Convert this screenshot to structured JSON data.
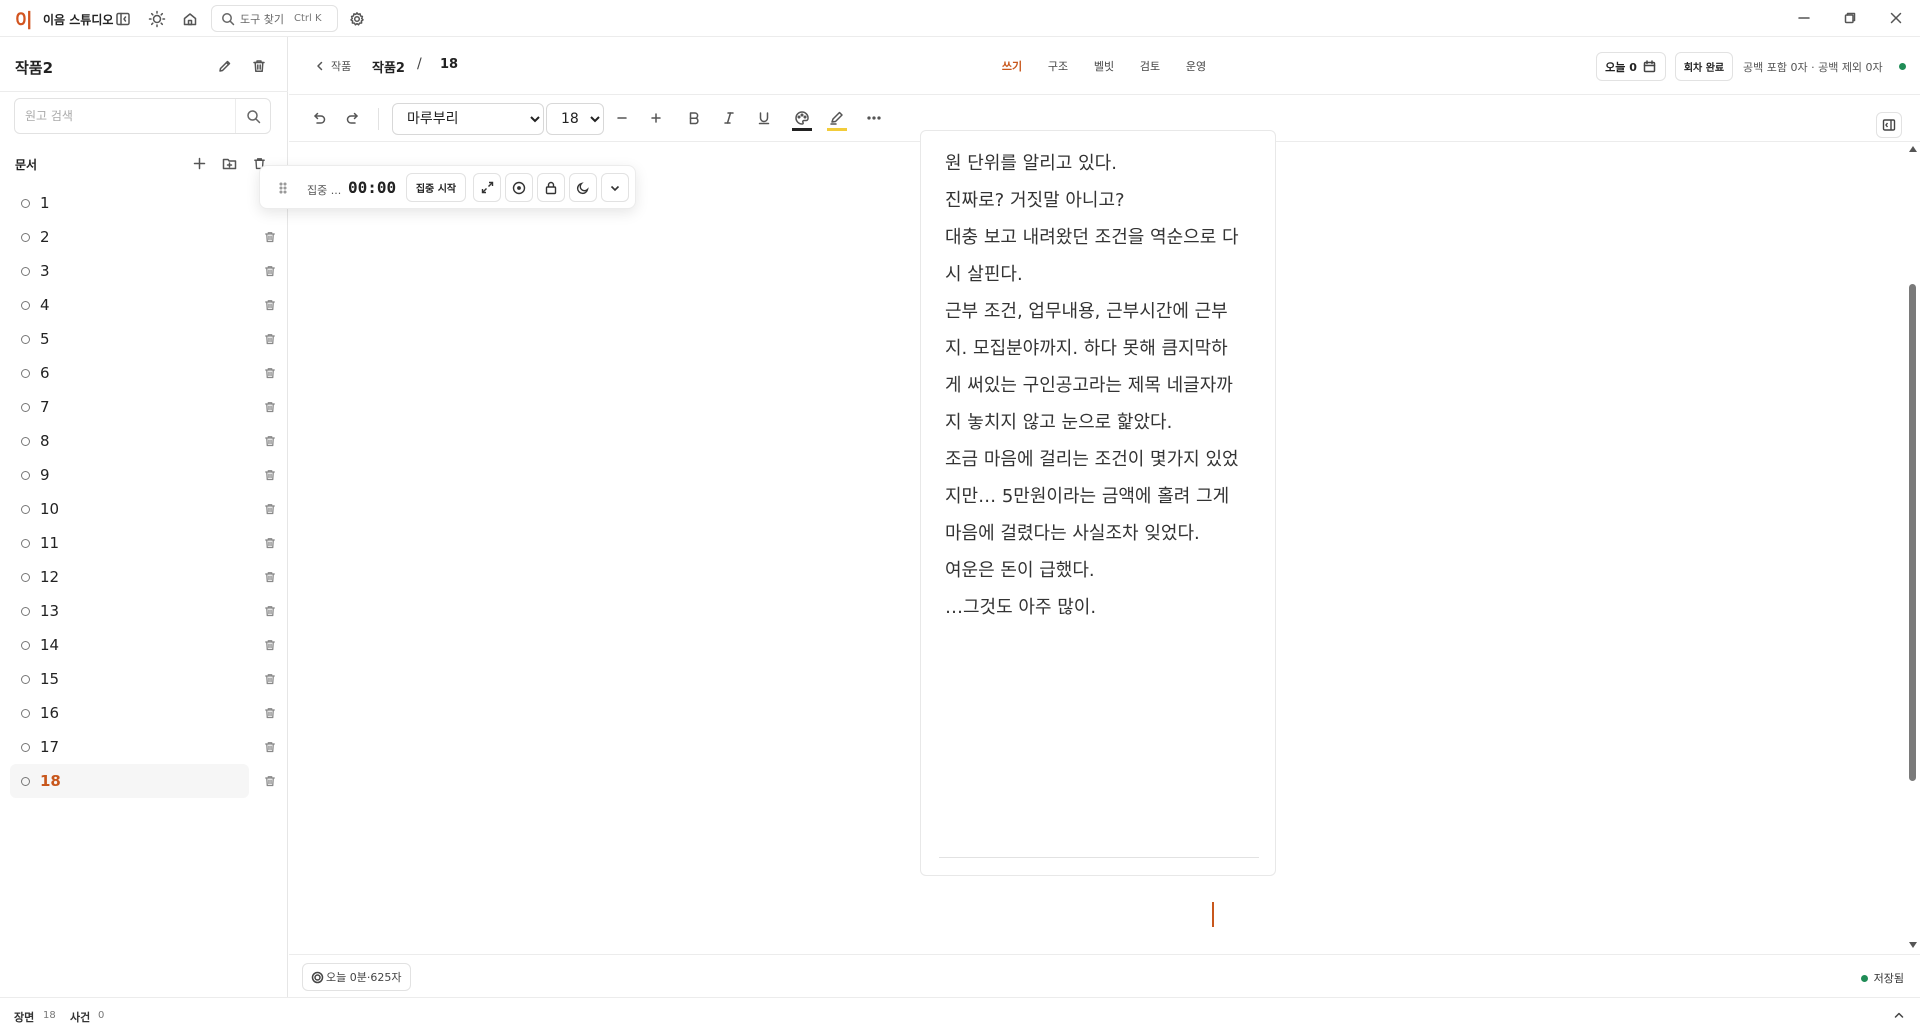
{
  "app": {
    "logo": "이",
    "name": "이음 스튜디오",
    "search_label": "도구 찾기",
    "search_shortcut": "Ctrl K"
  },
  "sidebar": {
    "project_title": "작품2",
    "draft_search_placeholder": "원고 검색",
    "docs_heading": "문서",
    "docs": [
      "1",
      "2",
      "3",
      "4",
      "5",
      "6",
      "7",
      "8",
      "9",
      "10",
      "11",
      "12",
      "13",
      "14",
      "15",
      "16",
      "17",
      "18"
    ],
    "active_doc": "18"
  },
  "header": {
    "back_label": "작품",
    "breadcrumb_project": "작품2",
    "breadcrumb_sep": "/",
    "breadcrumb_doc": "18",
    "tabs": [
      "쓰기",
      "구조",
      "벨빗",
      "검토",
      "운영"
    ],
    "active_tab": "쓰기",
    "today_label": "오늘 0",
    "done_label": "회차 완료",
    "char_count": "공백 포함 0자 · 공백 제외 0자"
  },
  "toolbar": {
    "font": "마루부리",
    "font_options": [
      "마루부리"
    ],
    "size": "18",
    "size_options": [
      "18"
    ],
    "text_color": "#222222",
    "highlight_color": "#f2cc3a"
  },
  "focus_widget": {
    "label": "집중 ...",
    "timer": "00:00",
    "start_label": "집중 시작"
  },
  "editor": {
    "lines": [
      "원 단위를 알리고 있다.",
      "진짜로? 거짓말 아니고?",
      "대충 보고 내려왔던 조건을 역순으로 다",
      "시 살핀다.",
      "근부 조건, 업무내용, 근부시간에 근부",
      "지. 모집분야까지. 하다 못해 큼지막하",
      "게 써있는 구인공고라는 제목 네글자까",
      "지 놓치지 않고 눈으로 핥았다.",
      "조금 마음에 걸리는 조건이 몇가지 있었",
      "지만… 5만원이라는 금액에 홀려 그게",
      "마음에 걸렸다는 사실조차 잊었다.",
      "여운은 돈이 급했다.",
      "…그것도 아주 많이."
    ]
  },
  "footer": {
    "today_stat": "오늘 0분·625자",
    "saved_label": "저장됨"
  },
  "statusbar": {
    "scene_label": "장면",
    "scene_value": "18",
    "event_label": "사건",
    "event_value": "0"
  },
  "colors": {
    "accent": "#c8571c",
    "saved_green": "#1f8c56"
  }
}
